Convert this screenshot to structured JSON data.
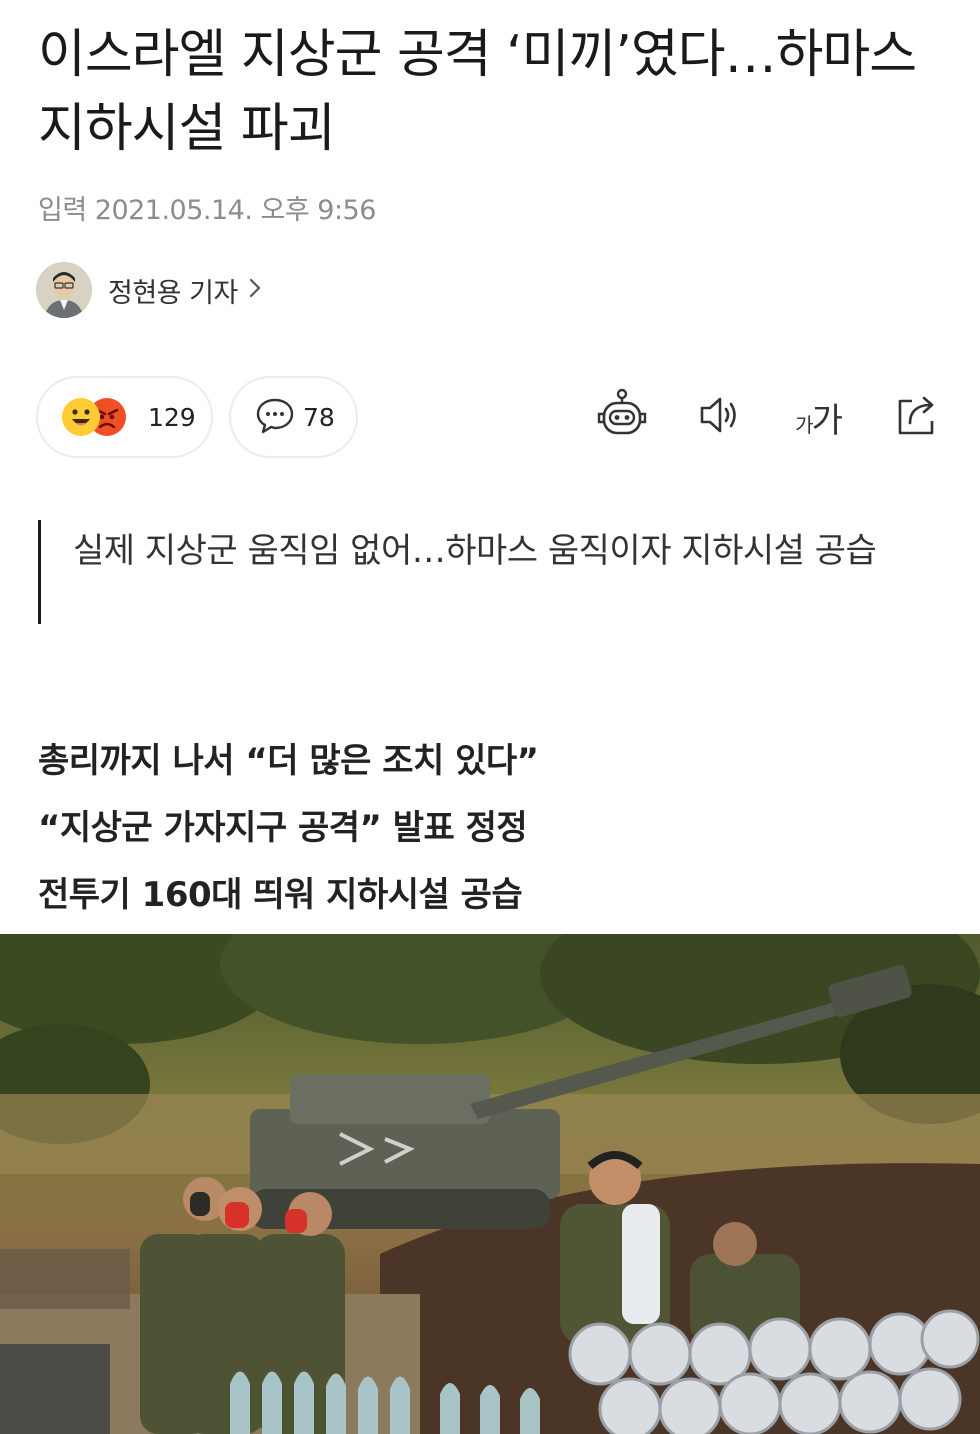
{
  "article": {
    "title": "이스라엘 지상군 공격 ‘미끼’였다…하마스 지하시설 파괴",
    "date": "입력 2021.05.14. 오후 9:56",
    "reporter": {
      "name": "정현용 기자",
      "chevron": "›"
    }
  },
  "reactions": {
    "count": "129",
    "icons": [
      "smile-emoji-icon",
      "angry-emoji-icon"
    ]
  },
  "comments": {
    "count": "78",
    "icon": "speech-bubble-icon"
  },
  "toolbar": {
    "items": [
      "summary-bot-icon",
      "speaker-icon",
      "font-size-icon",
      "share-icon"
    ],
    "font_small": "가",
    "font_large": "가"
  },
  "summary_quote": "실제 지상군 움직임 없어…하마스 움직이자 지하시설 공습",
  "subheads": [
    "총리까지 나서 “더 많은 조치 있다”",
    "“지상군 가자지구 공격” 발표 정정",
    "전투기 160대 띄워 지하시설 공습"
  ],
  "colors": {
    "text": "#1a1a1a",
    "meta": "#8c8c8c",
    "pill_border": "#ececec",
    "smile": "#ffcc33",
    "angry": "#f04e23"
  }
}
